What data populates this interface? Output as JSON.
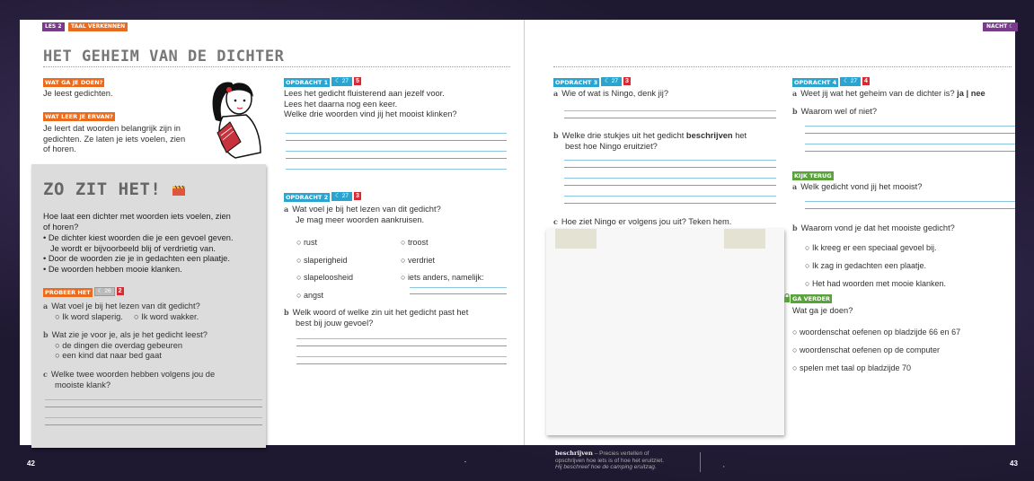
{
  "left": {
    "header": {
      "lesson": "LES 2",
      "section": "TAAL VERKENNEN"
    },
    "title": "HET GEHEIM VAN DE DICHTER",
    "wat_ga_je_doen": {
      "label": "WAT GA JE DOEN?",
      "text": "Je leest gedichten."
    },
    "wat_leer_je": {
      "label": "WAT LEER JE ERVAN?",
      "text": [
        "Je leert dat woorden belangrijk zijn in",
        "gedichten. Ze laten je iets voelen, zien",
        "of horen."
      ]
    },
    "zo_zit_het": {
      "title": "ZO ZIT HET!",
      "intro": [
        "Hoe laat een dichter met woorden iets voelen, zien",
        "of horen?"
      ],
      "bullets": [
        [
          "De dichter kiest woorden die je een gevoel geven.",
          "Je wordt er bijvoorbeeld blij of verdrietig van."
        ],
        [
          "Door de woorden zie je in gedachten een plaatje."
        ],
        [
          "De woorden hebben mooie klanken."
        ]
      ]
    },
    "probeer_het": {
      "label": "PROBEER HET",
      "moon": "26",
      "square": "2",
      "qa": {
        "letter": "a",
        "text": "Wat voel je bij het lezen van dit gedicht?",
        "options": [
          "Ik word slaperig.",
          "Ik word wakker."
        ]
      },
      "qb": {
        "letter": "b",
        "text": "Wat zie je voor je, als je het gedicht leest?",
        "options": [
          "de dingen die overdag gebeuren",
          "een kind dat naar bed gaat"
        ]
      },
      "qc": {
        "letter": "c",
        "text": [
          "Welke twee woorden hebben volgens jou de",
          "mooiste klank?"
        ]
      }
    },
    "opdracht1": {
      "label": "OPDRACHT 1",
      "moon": "27",
      "square": "5",
      "text": [
        "Lees het gedicht fluisterend aan jezelf voor.",
        "Lees het daarna nog een keer.",
        "Welke drie woorden vind jij het mooist klinken?"
      ]
    },
    "opdracht2": {
      "label": "OPDRACHT 2",
      "moon": "27",
      "square": "3",
      "qa": {
        "letter": "a",
        "text": [
          "Wat voel je bij het lezen van dit gedicht?",
          "Je mag meer woorden aankruisen."
        ]
      },
      "options_left": [
        "rust",
        "slaperigheid",
        "slapeloosheid",
        "angst"
      ],
      "options_right": [
        "troost",
        "verdriet",
        "iets anders, namelijk:"
      ],
      "qb": {
        "letter": "b",
        "text": [
          "Welk woord of welke zin uit het gedicht past het",
          "best bij jouw gevoel?"
        ]
      }
    },
    "page_number": "42"
  },
  "right": {
    "header": {
      "section": "NACHT"
    },
    "opdracht3": {
      "label": "OPDRACHT 3",
      "moon": "27",
      "square": "3",
      "qa": {
        "letter": "a",
        "text": "Wie of wat is Ningo, denk jij?"
      },
      "qb": {
        "letter": "b",
        "pre": "Welke drie stukjes uit het gedicht ",
        "bold": "beschrijven",
        "post": " het",
        "line2": "best hoe Ningo eruitziet?"
      },
      "qc": {
        "letter": "c",
        "text": "Hoe ziet Ningo er volgens jou uit? Teken hem."
      }
    },
    "opdracht4": {
      "label": "OPDRACHT 4",
      "moon": "27",
      "square": "4",
      "qa": {
        "letter": "a",
        "text": "Weet jij wat het geheim van de dichter is? ",
        "answer": "ja | nee"
      },
      "qb": {
        "letter": "b",
        "text": "Waarom wel of niet?"
      }
    },
    "kijk_terug": {
      "label": "KIJK TERUG",
      "qa": {
        "letter": "a",
        "text": "Welk gedicht vond jij het mooist?"
      },
      "qb": {
        "letter": "b",
        "text": "Waarom vond je dat het mooiste gedicht?",
        "options": [
          "Ik kreeg er een speciaal gevoel bij.",
          "Ik zag in gedachten een plaatje.",
          "Het had woorden met mooie klanken."
        ]
      }
    },
    "ga_verder": {
      "label": "GA VERDER",
      "text": "Wat ga je doen?",
      "options": [
        "woordenschat oefenen op bladzijde 66 en 67",
        "woordenschat oefenen op de computer",
        "spelen met taal op bladzijde 70"
      ]
    },
    "glossary": {
      "term": "beschrijven",
      "def": "– Precies vertellen of",
      "line2": "opschrijven hoe iets is of hoe het eruitziet.",
      "example": "Hij beschreef hoe de camping eruitzag."
    },
    "page_number": "43"
  },
  "colors": {
    "orange": "#ea6b1e",
    "blue": "#2ba5cf",
    "green": "#5aa23b",
    "purple": "#7a3b8c",
    "red": "#d62b35"
  },
  "icons": [
    "moon-icon",
    "clapperboard-icon",
    "girl-reading-illustration",
    "lock-icon"
  ]
}
